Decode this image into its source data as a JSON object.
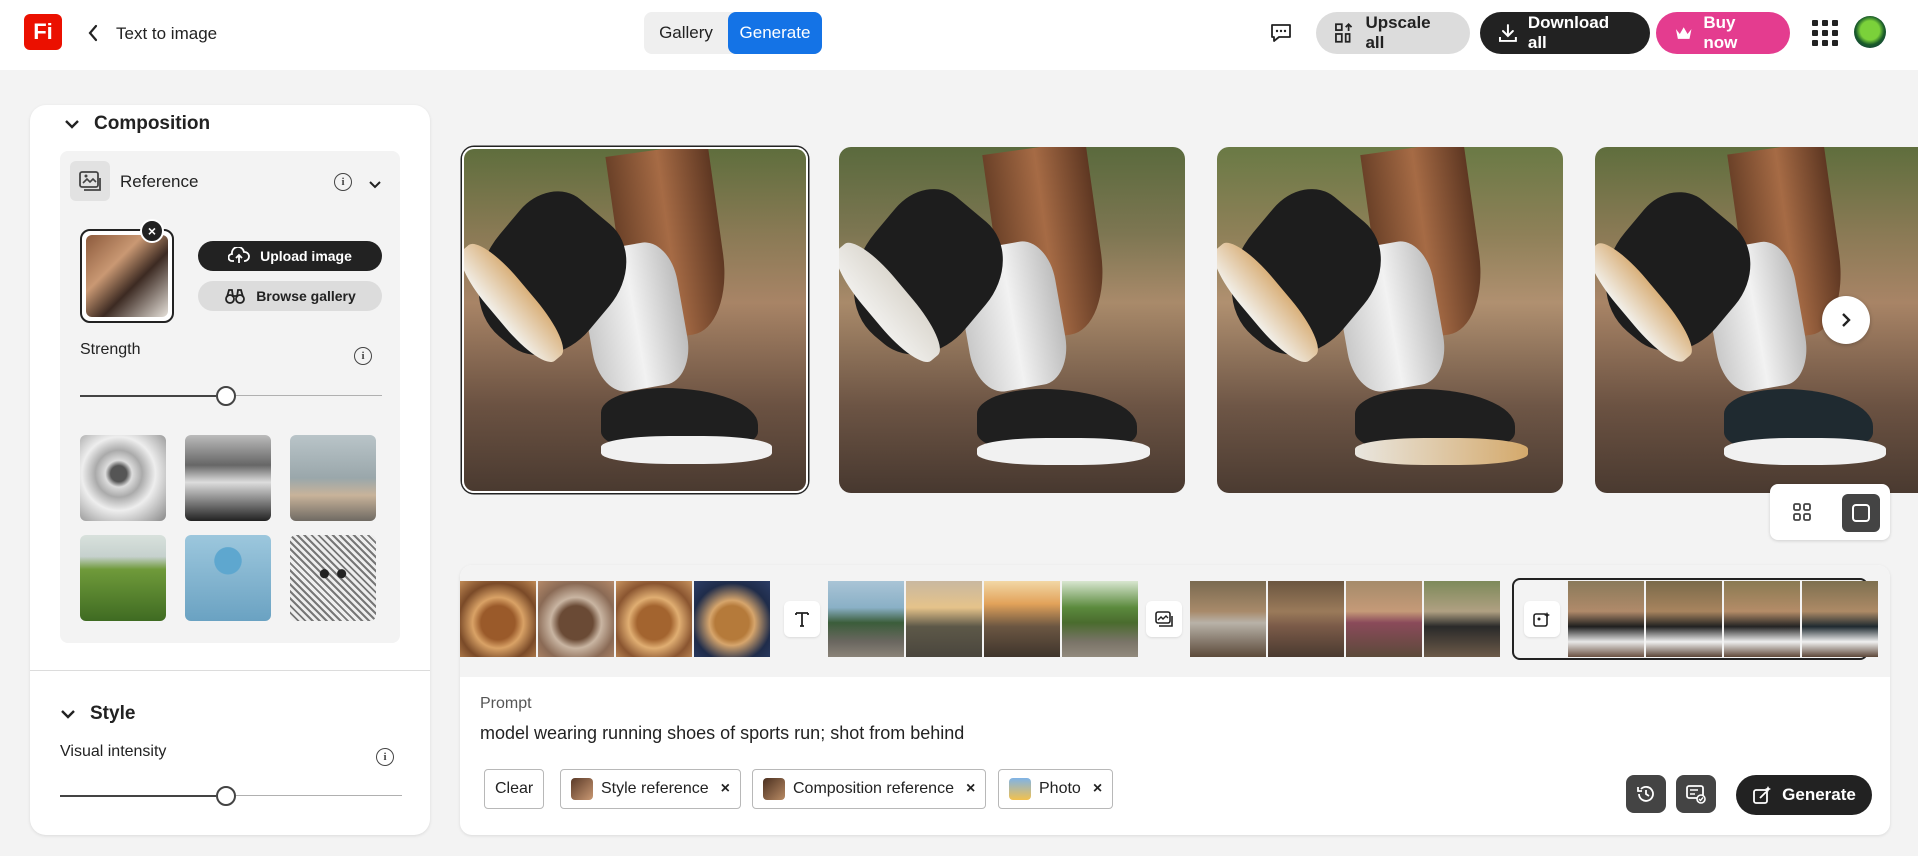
{
  "header": {
    "logo_text": "Fi",
    "breadcrumb": "Text to image",
    "tabs": [
      {
        "label": "Gallery"
      },
      {
        "label": "Generate"
      }
    ],
    "upscale_label": "Upscale all",
    "download_label": "Download all",
    "buy_label": "Buy now"
  },
  "panel": {
    "composition_title": "Composition",
    "reference_label": "Reference",
    "upload_label": "Upload image",
    "browse_label": "Browse gallery",
    "strength_label": "Strength",
    "strength_value": 0.5,
    "style_title": "Style",
    "visual_intensity_label": "Visual intensity",
    "visual_intensity_value": 0.5
  },
  "prompt": {
    "label": "Prompt",
    "text": "model wearing running shoes of sports run; shot from behind",
    "clear_label": "Clear",
    "chips": [
      {
        "label": "Style reference"
      },
      {
        "label": "Composition reference"
      },
      {
        "label": "Photo"
      }
    ],
    "generate_label": "Generate"
  },
  "colors": {
    "accent_blue": "#1473e6",
    "brand_red": "#eb1000",
    "buy_pink": "#e43c8f",
    "dark": "#222222"
  }
}
